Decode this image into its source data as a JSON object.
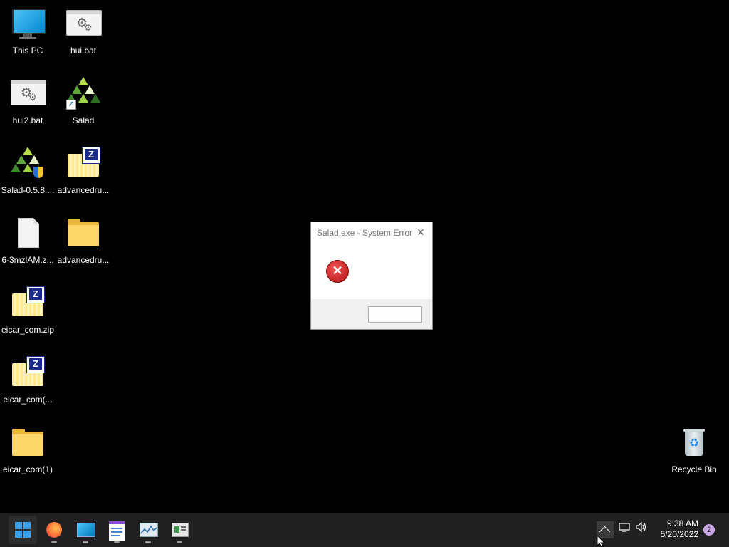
{
  "desktop": {
    "icons": [
      {
        "label": "This PC",
        "icon": "this-pc-icon"
      },
      {
        "label": "hui.bat",
        "icon": "batch-file-icon"
      },
      {
        "label": "hui2.bat",
        "icon": "batch-file-icon"
      },
      {
        "label": "Salad",
        "icon": "salad-shortcut-icon"
      },
      {
        "label": "Salad-0.5.8....",
        "icon": "salad-installer-icon"
      },
      {
        "label": "advancedru...",
        "icon": "zip-folder-icon"
      },
      {
        "label": "6-3mzlAM.z...",
        "icon": "blank-file-icon"
      },
      {
        "label": "advancedru...",
        "icon": "folder-icon"
      },
      {
        "label": "eicar_com.zip",
        "icon": "zip-folder-icon"
      },
      {
        "label": "eicar_com(...",
        "icon": "zip-folder-icon"
      },
      {
        "label": "eicar_com(1)",
        "icon": "folder-icon"
      },
      {
        "label": "Recycle Bin",
        "icon": "recycle-bin-icon"
      }
    ]
  },
  "dialog": {
    "title": "Salad.exe - System Error",
    "close_glyph": "✕",
    "icon": "error-icon",
    "ok_label": ""
  },
  "taskbar": {
    "apps": [
      {
        "name": "Start",
        "icon": "windows-start-icon"
      },
      {
        "name": "Firefox",
        "icon": "firefox-icon"
      },
      {
        "name": "Remote Desktop",
        "icon": "remote-desktop-icon"
      },
      {
        "name": "Notepad",
        "icon": "notepad-icon"
      },
      {
        "name": "Task Manager",
        "icon": "task-manager-icon"
      },
      {
        "name": "Calculator",
        "icon": "app-icon"
      }
    ],
    "tray": {
      "chevron": "^",
      "time": "9:38 AM",
      "date": "5/20/2022",
      "notifications": "2"
    }
  },
  "colors": {
    "desktop_bg": "#000000",
    "taskbar_bg": "#202020",
    "error_red": "#c62828",
    "folder_yellow": "#ffd86b",
    "zip_blue": "#1a2b8c"
  }
}
